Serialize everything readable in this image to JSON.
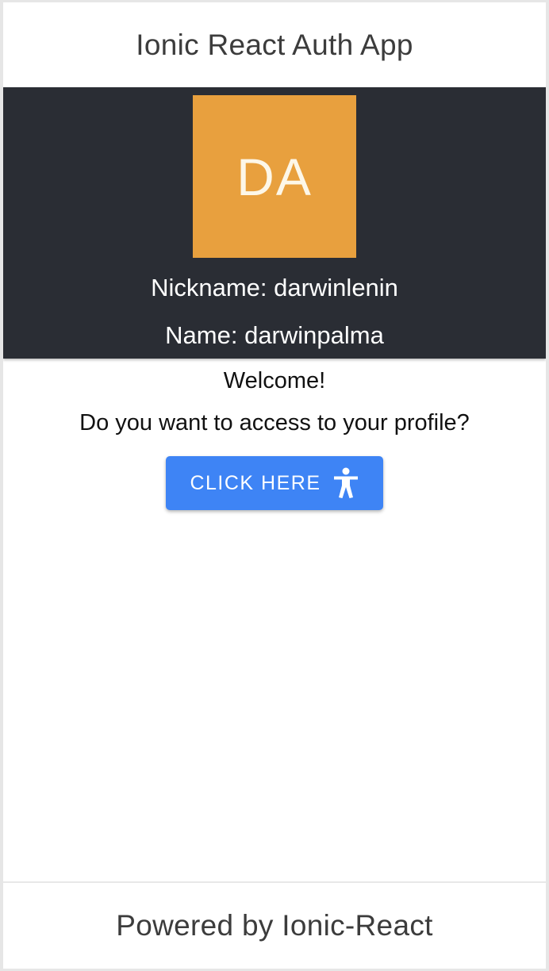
{
  "header": {
    "title": "Ionic React Auth App"
  },
  "profile": {
    "avatar_initials": "DA",
    "avatar_color": "#e8a03e",
    "band_color": "#2a2d34",
    "nickname_line": "Nickname: darwinlenin",
    "name_line": "Name: darwinpalma"
  },
  "main": {
    "welcome": "Welcome!",
    "question": "Do you want to access to your profile?",
    "button": {
      "label": "CLICK HERE",
      "icon": "accessibility-icon",
      "color": "#3e84f5"
    }
  },
  "footer": {
    "title": "Powered by Ionic-React"
  }
}
